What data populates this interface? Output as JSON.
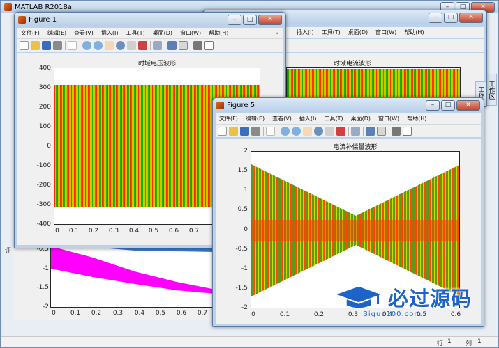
{
  "app": {
    "title": "MATLAB R2018a",
    "side_panel_label": "工作区",
    "left_stub_text": "评",
    "status_row_label": "行",
    "status_row_value": "1",
    "status_col_label": "列",
    "status_col_value": "1"
  },
  "menu_items": [
    "文件(F)",
    "编辑(E)",
    "查看(V)",
    "插入(I)",
    "工具(T)",
    "桌面(D)",
    "窗口(W)",
    "帮助(H)"
  ],
  "figure1": {
    "title": "Figure 1",
    "plot_title": "时域电压波形",
    "yticks": [
      "400",
      "300",
      "200",
      "100",
      "0",
      "-100",
      "-200",
      "-300",
      "-400"
    ],
    "xticks": [
      "0",
      "0.1",
      "0.2",
      "0.3",
      "0.4",
      "0.5",
      "0.6",
      "0.7"
    ]
  },
  "figure2": {
    "plot_title": "时域电流波形"
  },
  "figure5": {
    "title": "Figure 5",
    "plot_title": "电流补偿量波形",
    "yticks": [
      "2",
      "1.5",
      "1",
      "0.5",
      "0",
      "-0.5",
      "-1",
      "-1.5",
      "-2"
    ],
    "xticks": [
      "0",
      "0.1",
      "0.2",
      "0.3",
      "0.4",
      "0.5",
      "0.6"
    ]
  },
  "background_figure": {
    "yticks": [
      "-0.5",
      "-1",
      "-1.5",
      "-2"
    ],
    "xticks": [
      "0",
      "0.1",
      "0.2",
      "0.3",
      "0.4",
      "0.5",
      "0.6",
      "0.7"
    ]
  },
  "watermark": {
    "text": "必过源码",
    "subtext": "Biguo100.com"
  },
  "chart_data": [
    {
      "type": "line",
      "title": "时域电压波形",
      "description_series": [
        {
          "name": "",
          "color": "#ff0000",
          "amplitude": 311
        },
        {
          "name": "",
          "color": "#00c000",
          "amplitude": 311
        },
        {
          "name": "",
          "color": "#ffd400",
          "amplitude": 311
        }
      ],
      "xlim": [
        0,
        0.75
      ],
      "ylim": [
        -400,
        400
      ]
    },
    {
      "type": "line",
      "title": "电流补偿量波形",
      "xlim": [
        0,
        0.6
      ],
      "ylim": [
        -2,
        2
      ],
      "envelope_peak": 1.65
    }
  ],
  "colors": {
    "wave_red": "#ff2a00",
    "wave_green": "#1fb500",
    "wave_yellow": "#e6e600",
    "magenta": "#ff00ff",
    "blue": "#1e63c7"
  }
}
